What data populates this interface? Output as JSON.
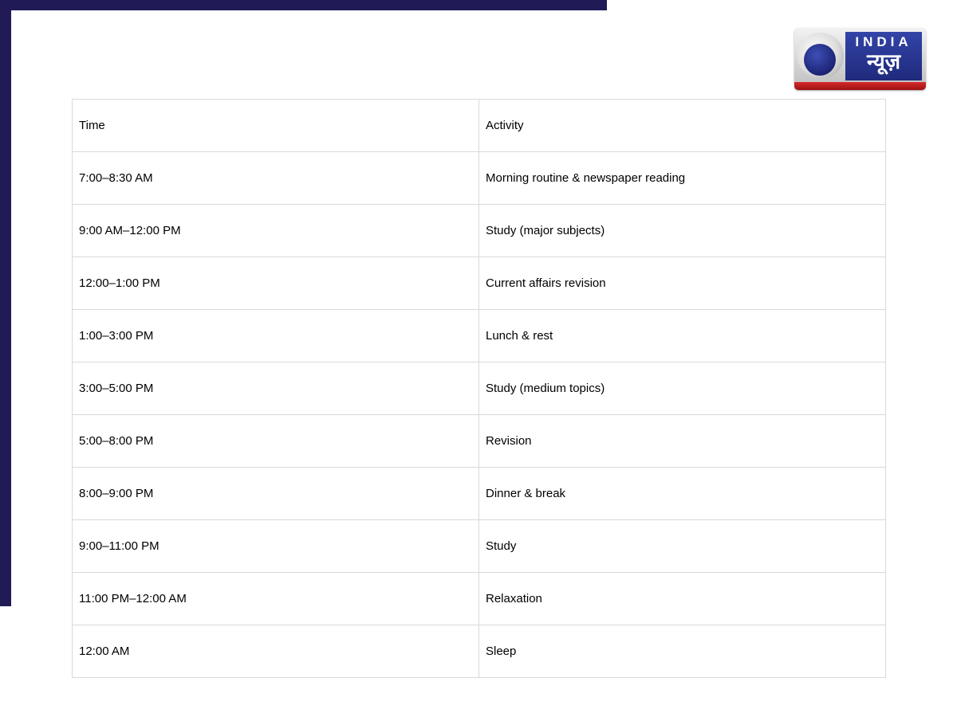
{
  "logo": {
    "line1": "INDIA",
    "line2": "न्यूज़",
    "colors": {
      "panel": "#2a3896",
      "stripe": "#c01c1c"
    },
    "icon": "globe-icon"
  },
  "frame_color": "#201a57",
  "table": {
    "headers": [
      "Time",
      "Activity"
    ],
    "rows": [
      [
        "7:00–8:30 AM",
        "Morning routine & newspaper reading"
      ],
      [
        "9:00 AM–12:00 PM",
        "Study (major subjects)"
      ],
      [
        "12:00–1:00 PM",
        "Current affairs revision"
      ],
      [
        "1:00–3:00 PM",
        "Lunch & rest"
      ],
      [
        "3:00–5:00 PM",
        "Study (medium topics)"
      ],
      [
        "5:00–8:00 PM",
        "Revision"
      ],
      [
        "8:00–9:00 PM",
        "Dinner & break"
      ],
      [
        "9:00–11:00 PM",
        "Study"
      ],
      [
        "11:00 PM–12:00 AM",
        "Relaxation"
      ],
      [
        "12:00 AM",
        "Sleep"
      ]
    ]
  }
}
